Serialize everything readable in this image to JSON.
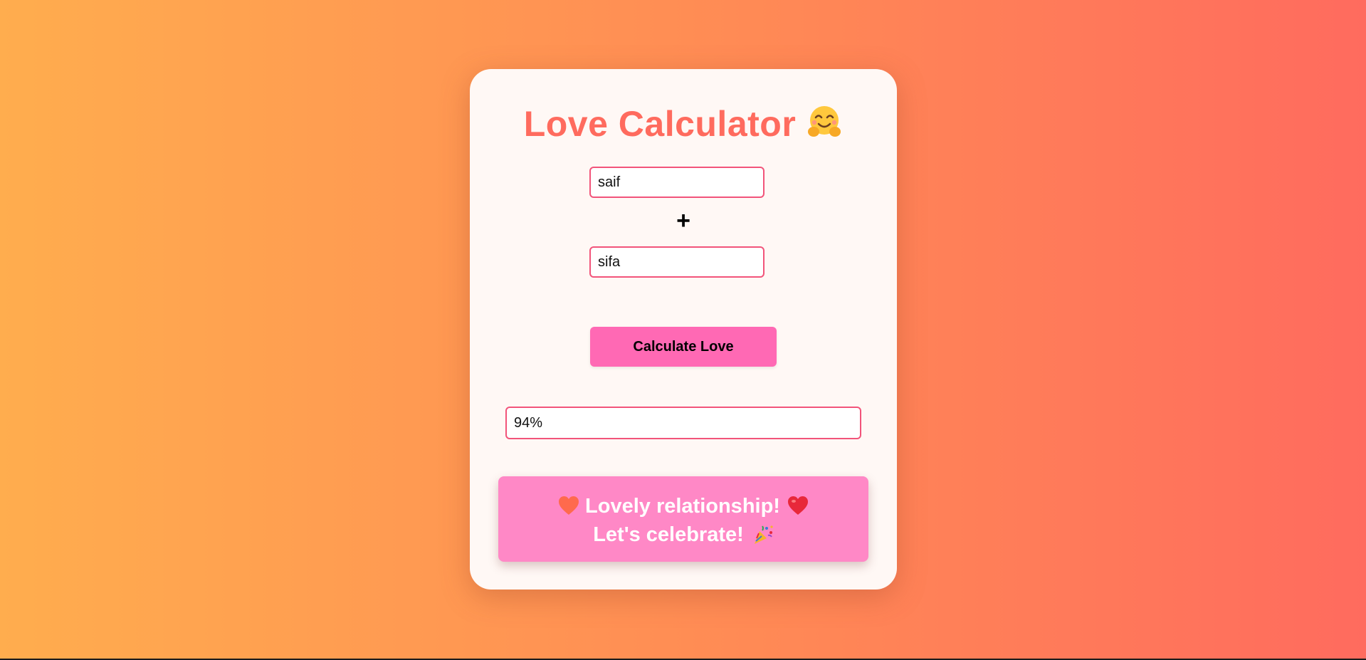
{
  "app": {
    "title": "Love Calculator"
  },
  "form": {
    "name1_value": "saif",
    "plus_symbol": "+",
    "name2_value": "sifa",
    "calculate_label": "Calculate Love",
    "result_value": "94%"
  },
  "message": {
    "line1": "Lovely relationship!",
    "line2": "Let's celebrate!"
  },
  "icons": {
    "title_emoji": "hugging-face-icon",
    "heart_left": "orange-heart-icon",
    "heart_right": "red-heart-icon",
    "celebrate": "party-popper-icon"
  },
  "colors": {
    "accent": "#ff6b5e",
    "button": "#ff69b4",
    "message_bg": "#ff88c6",
    "input_border": "#f2547a"
  }
}
